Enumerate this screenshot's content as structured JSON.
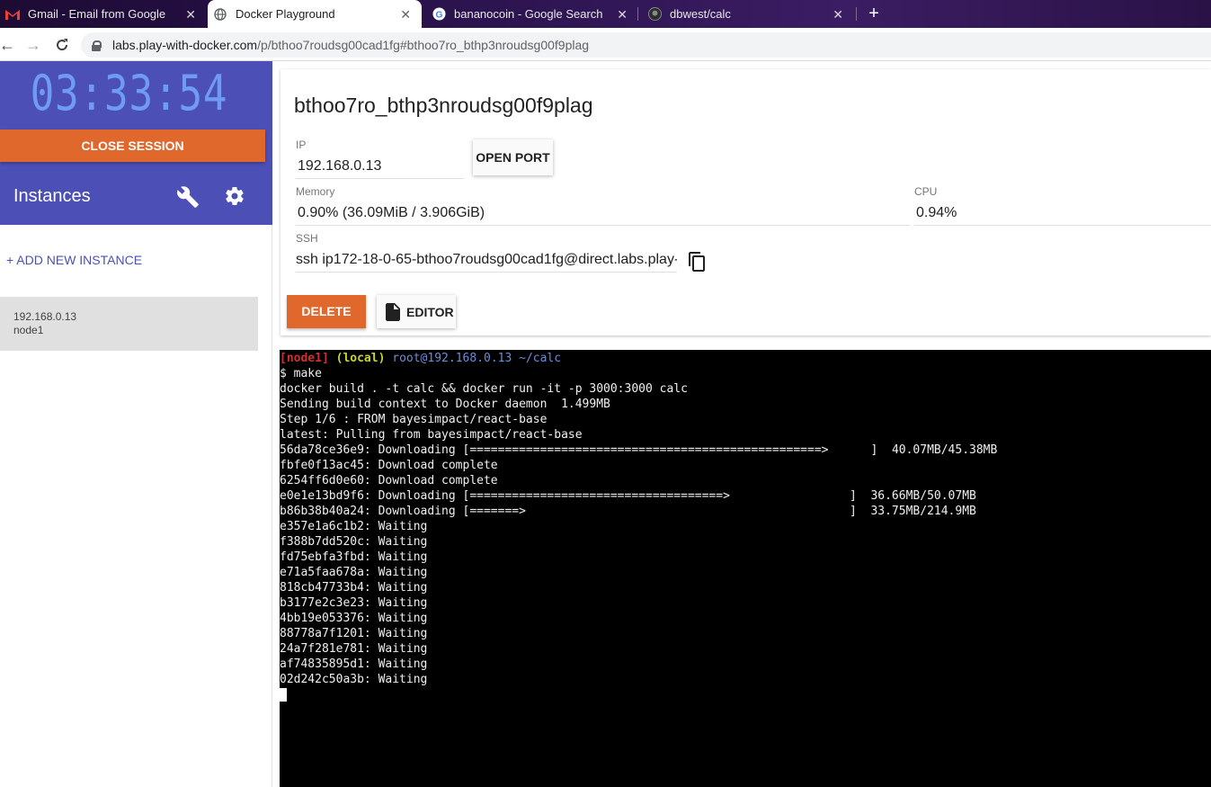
{
  "browser": {
    "tabs": [
      {
        "title": "Gmail - Email from Google",
        "icon": "gmail-icon",
        "active": false
      },
      {
        "title": "Docker Playground",
        "icon": "globe-icon",
        "active": true
      },
      {
        "title": "bananocoin - Google Search",
        "icon": "google-icon",
        "active": false
      },
      {
        "title": "dbwest/calc",
        "icon": "github-icon",
        "active": false
      }
    ],
    "url_host": "labs.play-with-docker.com",
    "url_path": "/p/bthoo7roudsg00cad1fg#bthoo7ro_bthp3nroudsg00f9plag"
  },
  "sidebar": {
    "timer": "03:33:54",
    "close_session_label": "CLOSE SESSION",
    "instances_title": "Instances",
    "add_instance_label": "+ ADD NEW INSTANCE",
    "instances": [
      {
        "ip": "192.168.0.13",
        "name": "node1"
      }
    ]
  },
  "instance": {
    "title": "bthoo7ro_bthp3nroudsg00f9plag",
    "ip_label": "IP",
    "ip_value": "192.168.0.13",
    "open_port_label": "OPEN PORT",
    "memory_label": "Memory",
    "memory_value": "0.90% (36.09MiB / 3.906GiB)",
    "cpu_label": "CPU",
    "cpu_value": "0.94%",
    "ssh_label": "SSH",
    "ssh_value": "ssh ip172-18-0-65-bthoo7roudsg00cad1fg@direct.labs.play-",
    "delete_label": "DELETE",
    "editor_label": "EDITOR"
  },
  "terminal": {
    "prompt": {
      "node": "[node1]",
      "local": "(local)",
      "userpath": "root@192.168.0.13 ~/calc"
    },
    "lines": [
      "$ make",
      "docker build . -t calc && docker run -it -p 3000:3000 calc",
      "Sending build context to Docker daemon  1.499MB",
      "Step 1/6 : FROM bayesimpact/react-base",
      "latest: Pulling from bayesimpact/react-base"
    ],
    "progress_lines": [
      {
        "prefix": "56da78ce36e9: Downloading [==================================================>      ]",
        "size": "40.07MB/45.38MB"
      },
      {
        "prefix": "fbfe0f13ac45: Download complete",
        "size": ""
      },
      {
        "prefix": "6254ff6d0e60: Download complete",
        "size": ""
      },
      {
        "prefix": "e0e1e13bd9f6: Downloading [====================================>                 ]",
        "size": "36.66MB/50.07MB"
      },
      {
        "prefix": "b86b38b40a24: Downloading [=======>                                              ]",
        "size": "33.75MB/214.9MB"
      }
    ],
    "waiting_lines": [
      "e357e1a6c1b2: Waiting",
      "f388b7dd520c: Waiting",
      "fd75ebfa3fbd: Waiting",
      "e71a5faa678a: Waiting",
      "818cb47733b4: Waiting",
      "b3177e2c3e23: Waiting",
      "4bb19e053376: Waiting",
      "88778a7f1201: Waiting",
      "24a7f281e781: Waiting",
      "af74835895d1: Waiting",
      "02d242c50a3b: Waiting"
    ]
  },
  "colors": {
    "accent": "#4c50b6",
    "danger": "#e0682d",
    "timer": "#6f9cf2"
  }
}
